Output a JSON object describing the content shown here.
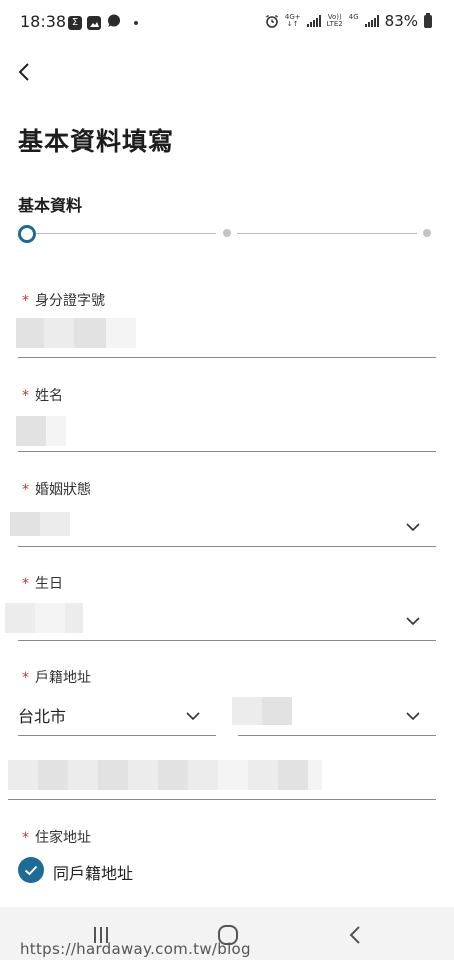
{
  "status_bar": {
    "time": "18:38",
    "icons_left": [
      "sigma-icon",
      "image-icon",
      "chat-icon"
    ],
    "network_1": "4G+",
    "network_2_top": "Vo))",
    "network_2_bottom": "LTE2",
    "network_3": "4G",
    "battery": "83%"
  },
  "header": {
    "back_label": "back",
    "title": "基本資料填寫"
  },
  "stepper": {
    "current_step": "基本資料",
    "current_index": 1,
    "total_steps": 3
  },
  "form": {
    "required_mark": "*",
    "id_number": {
      "label": "身分證字號"
    },
    "name": {
      "label": "姓名"
    },
    "marital_status": {
      "label": "婚姻狀態"
    },
    "birthday": {
      "label": "生日"
    },
    "registered_address": {
      "label": "戶籍地址",
      "city": "台北市"
    },
    "home_address": {
      "label": "住家地址",
      "same_as_registered": "同戶籍地址",
      "same_checked": true
    }
  },
  "watermark": "https://hardaway.com.tw/blog",
  "colors": {
    "accent": "#1e6b95",
    "required": "#c0392b"
  }
}
